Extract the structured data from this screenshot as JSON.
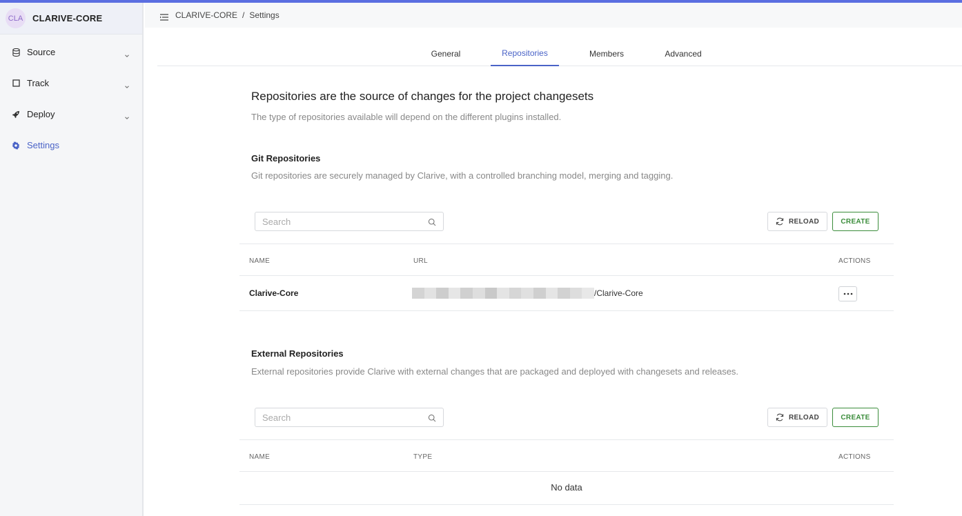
{
  "colors": {
    "accent": "#4a63c7",
    "top_bar": "#5b6ee1",
    "create_green": "#3a8c3a"
  },
  "sidebar": {
    "avatar_text": "CLA",
    "project_name": "CLARIVE-CORE",
    "items": [
      {
        "label": "Source",
        "icon": "database-icon",
        "has_chevron": true
      },
      {
        "label": "Track",
        "icon": "square-icon",
        "has_chevron": true
      },
      {
        "label": "Deploy",
        "icon": "rocket-icon",
        "has_chevron": true
      },
      {
        "label": "Settings",
        "icon": "gear-icon",
        "active": true
      }
    ]
  },
  "header": {
    "breadcrumb": [
      "CLARIVE-CORE",
      "Settings"
    ],
    "separator": "/"
  },
  "tabs": [
    {
      "label": "General"
    },
    {
      "label": "Repositories",
      "active": true
    },
    {
      "label": "Members"
    },
    {
      "label": "Advanced"
    }
  ],
  "main": {
    "title": "Repositories are the source of changes for the project changesets",
    "subtitle": "The type of repositories available will depend on the different plugins installed."
  },
  "git": {
    "title": "Git Repositories",
    "description": "Git repositories are securely managed by Clarive, with a controlled branching model, merging and tagging.",
    "search_placeholder": "Search",
    "reload_label": "RELOAD",
    "create_label": "CREATE",
    "columns": [
      "NAME",
      "URL",
      "ACTIONS"
    ],
    "rows": [
      {
        "name": "Clarive-Core",
        "url_suffix": "/Clarive-Core"
      }
    ]
  },
  "external": {
    "title": "External Repositories",
    "description": "External repositories provide Clarive with external changes that are packaged and deployed with changesets and releases.",
    "search_placeholder": "Search",
    "reload_label": "RELOAD",
    "create_label": "CREATE",
    "columns": [
      "NAME",
      "TYPE",
      "ACTIONS"
    ],
    "empty_text": "No data"
  }
}
